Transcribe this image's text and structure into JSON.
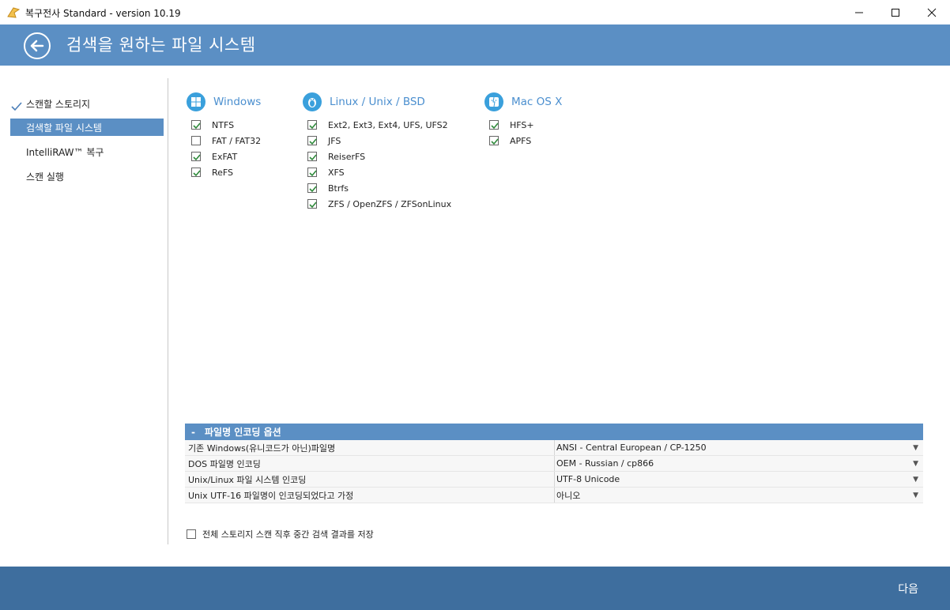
{
  "window": {
    "title": "복구전사 Standard - version 10.19"
  },
  "header": {
    "title": "검색을 원하는 파일 시스템"
  },
  "sidebar": {
    "items": [
      {
        "label": "스캔할 스토리지",
        "done": true,
        "active": false
      },
      {
        "label": "검색할 파일 시스템",
        "done": false,
        "active": true
      },
      {
        "label": "IntelliRAW™ 복구",
        "done": false,
        "active": false
      },
      {
        "label": "스캔 실행",
        "done": false,
        "active": false
      }
    ]
  },
  "filesystems": {
    "windows": {
      "label": "Windows",
      "icon": "windows-icon",
      "items": [
        {
          "label": "NTFS",
          "checked": true
        },
        {
          "label": "FAT / FAT32",
          "checked": false
        },
        {
          "label": "ExFAT",
          "checked": true
        },
        {
          "label": "ReFS",
          "checked": true
        }
      ]
    },
    "linux": {
      "label": "Linux / Unix / BSD",
      "icon": "linux-penguin-icon",
      "items": [
        {
          "label": "Ext2, Ext3, Ext4, UFS, UFS2",
          "checked": true
        },
        {
          "label": "JFS",
          "checked": true
        },
        {
          "label": "ReiserFS",
          "checked": true
        },
        {
          "label": "XFS",
          "checked": true
        },
        {
          "label": "Btrfs",
          "checked": true
        },
        {
          "label": "ZFS / OpenZFS / ZFSonLinux",
          "checked": true
        }
      ]
    },
    "mac": {
      "label": "Mac OS X",
      "icon": "mac-finder-icon",
      "items": [
        {
          "label": "HFS+",
          "checked": true
        },
        {
          "label": "APFS",
          "checked": true
        }
      ]
    }
  },
  "encoding": {
    "title": "파일명 인코딩 옵션",
    "collapse_symbol": "-",
    "rows": [
      {
        "label": "기존 Windows(유니코드가 아닌)파일명",
        "value": "ANSI - Central European / CP-1250"
      },
      {
        "label": "DOS 파일명 인코딩",
        "value": "OEM - Russian / cp866"
      },
      {
        "label": "Unix/Linux 파일 시스템 인코딩",
        "value": "UTF-8 Unicode"
      },
      {
        "label": "Unix UTF-16 파일명이 인코딩되었다고 가정",
        "value": "아니오"
      }
    ]
  },
  "save_option": {
    "label": "전체 스토리지 스캔 직후 중간 검색 결과를 저장",
    "checked": false
  },
  "footer": {
    "next_label": "다음"
  },
  "colors": {
    "accent": "#5b8fc4",
    "footer": "#3e6e9e",
    "checkmark": "#2f8a3b",
    "fs_icon": "#3aa0dc"
  }
}
